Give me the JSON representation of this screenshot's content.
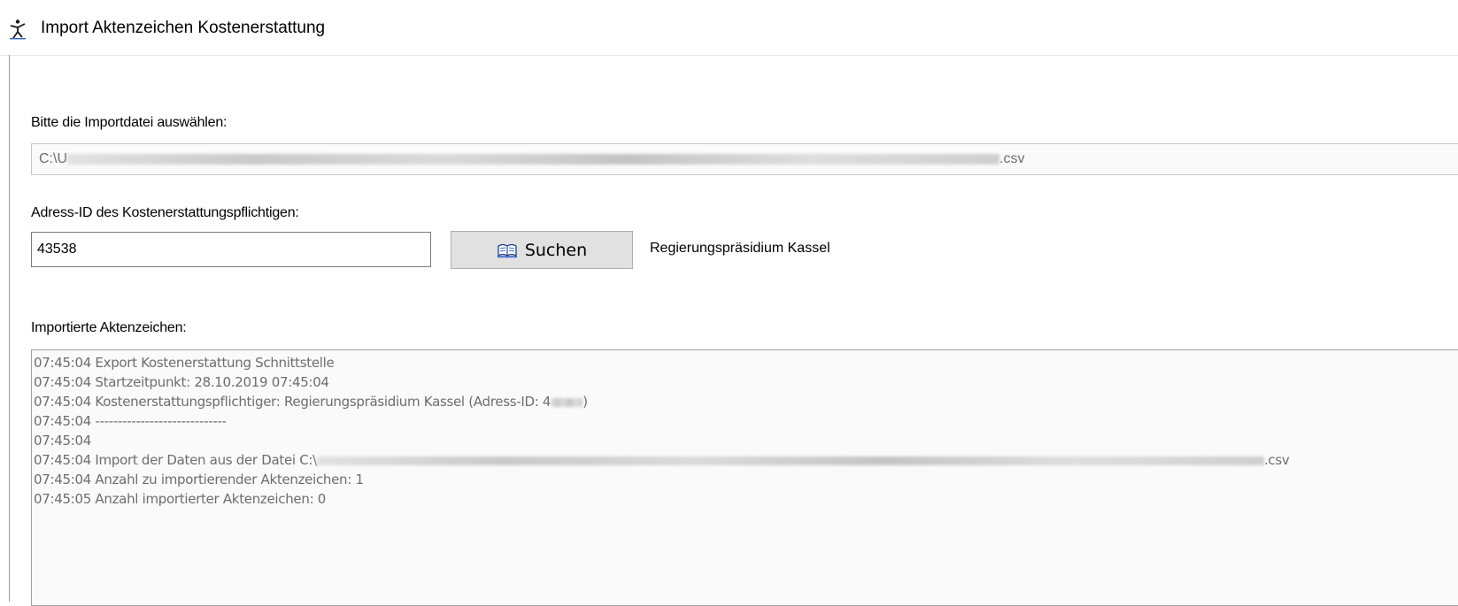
{
  "window": {
    "title": "Import Aktenzeichen Kostenerstattung",
    "icon": "app-dancer-icon"
  },
  "form": {
    "import_file_label": "Bitte die Importdatei auswählen:",
    "import_file_value_start": "C:\\U",
    "import_file_value_end": ".csv",
    "address_label": "Adress-ID des Kostenerstattungspflichtigen:",
    "address_value": "43538",
    "search_button_label": "Suchen",
    "search_button_icon": "book-search-icon",
    "address_name": "Regierungspräsidium Kassel",
    "log_label": "Importierte Aktenzeichen:"
  },
  "log": [
    {
      "text": "07:45:04  Export Kostenerstattung Schnittstelle"
    },
    {
      "text": "07:45:04  Startzeitpunkt: 28.10.2019 07:45:04"
    },
    {
      "text": "07:45:04  Kostenerstattungspflichtiger: Regierungspräsidium Kassel (Adress-ID: 4",
      "suffix": ")"
    },
    {
      "text": "07:45:04  -----------------------------"
    },
    {
      "text": "07:45:04"
    },
    {
      "text": "07:45:04  Import der Daten aus der Datei C:\\",
      "suffix": ".csv"
    },
    {
      "text": "07:45:04  Anzahl zu importierender Aktenzeichen: 1"
    },
    {
      "text": "07:45:05  Anzahl importierter Aktenzeichen: 0"
    }
  ]
}
